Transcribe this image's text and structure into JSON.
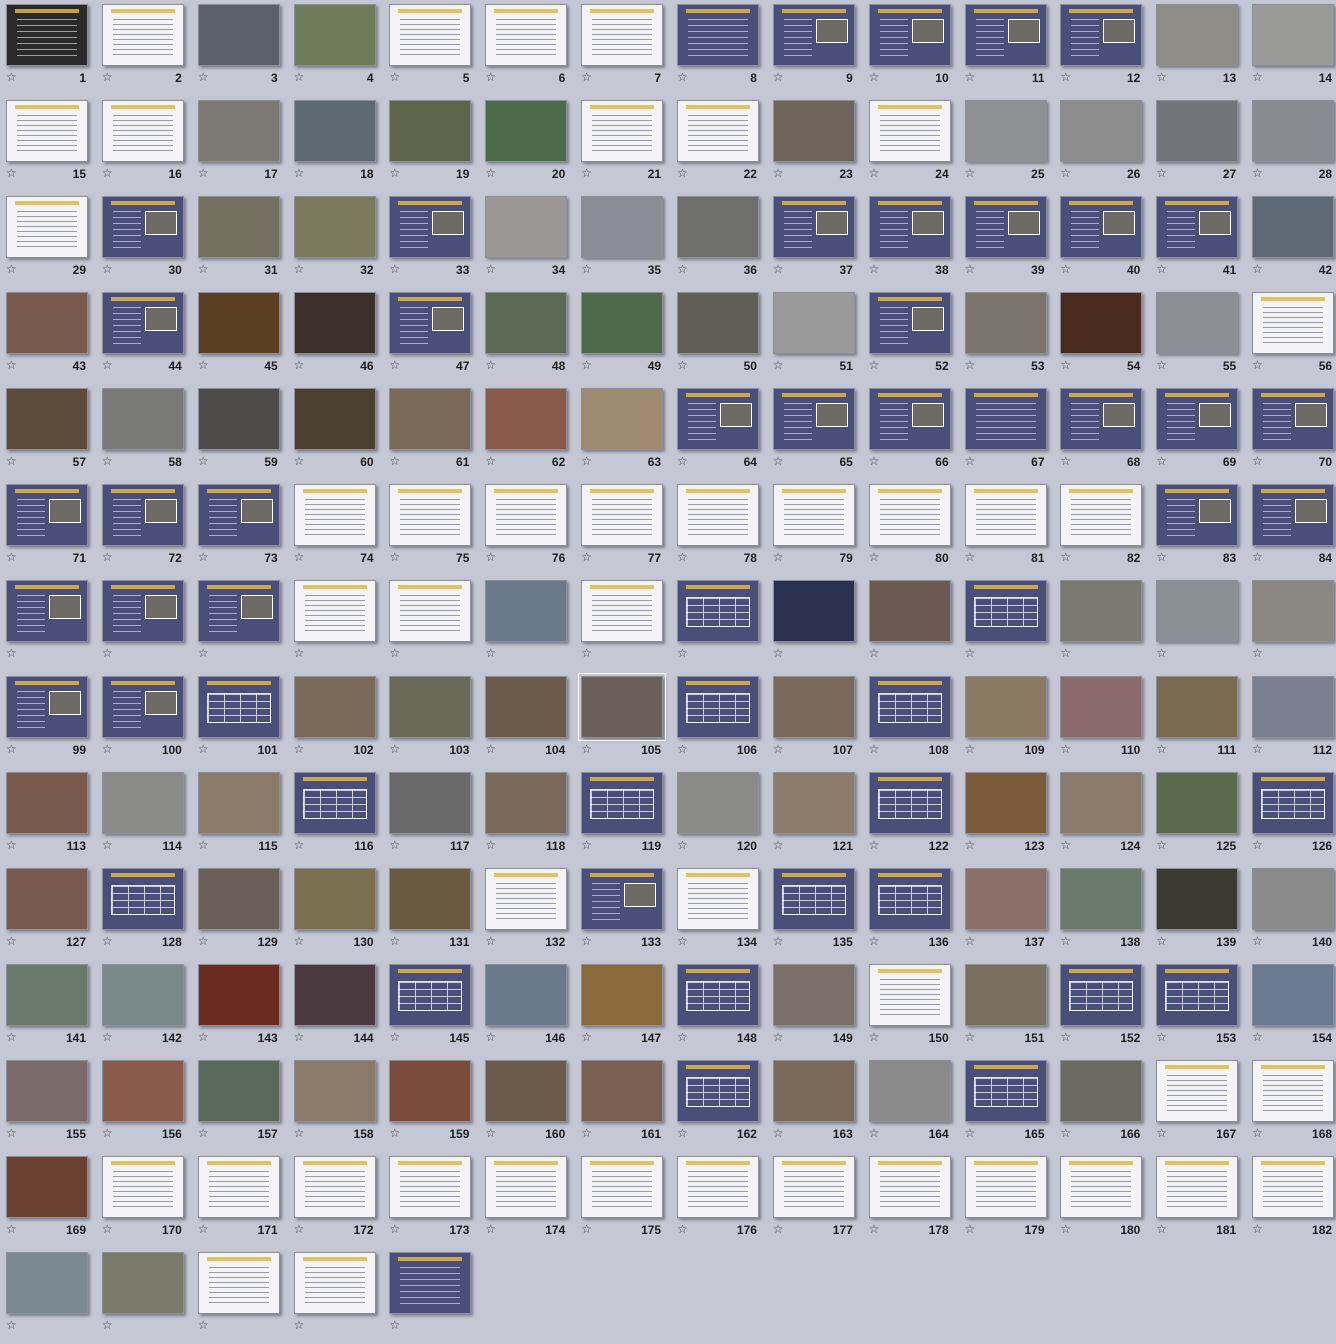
{
  "slides": [
    {
      "number": "1",
      "style": "dark"
    },
    {
      "number": "2",
      "style": "white"
    },
    {
      "number": "3",
      "style": "photo",
      "color": "#5a5f6a"
    },
    {
      "number": "4",
      "style": "photo",
      "color": "#6f7c5a"
    },
    {
      "number": "5",
      "style": "white"
    },
    {
      "number": "6",
      "style": "white"
    },
    {
      "number": "7",
      "style": "white"
    },
    {
      "number": "8",
      "style": "blue"
    },
    {
      "number": "9",
      "style": "blue-photo"
    },
    {
      "number": "10",
      "style": "blue-photo"
    },
    {
      "number": "11",
      "style": "blue-photo"
    },
    {
      "number": "12",
      "style": "blue-photo"
    },
    {
      "number": "13",
      "style": "photo",
      "color": "#8d8c86"
    },
    {
      "number": "14",
      "style": "photo",
      "color": "#9a9a98"
    },
    {
      "number": "15",
      "style": "white"
    },
    {
      "number": "16",
      "style": "white"
    },
    {
      "number": "17",
      "style": "photo",
      "color": "#7d7a73"
    },
    {
      "number": "18",
      "style": "photo",
      "color": "#5e6a72"
    },
    {
      "number": "19",
      "style": "photo",
      "color": "#5d6447"
    },
    {
      "number": "20",
      "style": "photo",
      "color": "#4b6a48"
    },
    {
      "number": "21",
      "style": "white"
    },
    {
      "number": "22",
      "style": "white"
    },
    {
      "number": "23",
      "style": "photo",
      "color": "#6f665b"
    },
    {
      "number": "24",
      "style": "white"
    },
    {
      "number": "25",
      "style": "photo",
      "color": "#8f9093"
    },
    {
      "number": "26",
      "style": "photo",
      "color": "#8c8c8c"
    },
    {
      "number": "27",
      "style": "photo",
      "color": "#73747a"
    },
    {
      "number": "28",
      "style": "photo",
      "color": "#8a8b90"
    },
    {
      "number": "29",
      "style": "white"
    },
    {
      "number": "30",
      "style": "blue-photo"
    },
    {
      "number": "31",
      "style": "photo",
      "color": "#74705f"
    },
    {
      "number": "32",
      "style": "photo",
      "color": "#7b7a5d"
    },
    {
      "number": "33",
      "style": "blue-photo"
    },
    {
      "number": "34",
      "style": "photo",
      "color": "#9b9795"
    },
    {
      "number": "35",
      "style": "photo",
      "color": "#8a8d95"
    },
    {
      "number": "36",
      "style": "photo",
      "color": "#6e6e6a"
    },
    {
      "number": "37",
      "style": "blue-photo"
    },
    {
      "number": "38",
      "style": "blue-photo"
    },
    {
      "number": "39",
      "style": "blue-photo"
    },
    {
      "number": "40",
      "style": "blue-photo"
    },
    {
      "number": "41",
      "style": "blue-photo"
    },
    {
      "number": "42",
      "style": "photo",
      "color": "#5e6a76"
    },
    {
      "number": "43",
      "style": "photo",
      "color": "#7a5a4c"
    },
    {
      "number": "44",
      "style": "blue-photo"
    },
    {
      "number": "45",
      "style": "photo",
      "color": "#5b3f22"
    },
    {
      "number": "46",
      "style": "photo",
      "color": "#3b2f2a"
    },
    {
      "number": "47",
      "style": "blue-photo"
    },
    {
      "number": "48",
      "style": "photo",
      "color": "#5c6a55"
    },
    {
      "number": "49",
      "style": "photo",
      "color": "#4f6a4a"
    },
    {
      "number": "50",
      "style": "photo",
      "color": "#5f5f56"
    },
    {
      "number": "51",
      "style": "photo",
      "color": "#9a9a9a"
    },
    {
      "number": "52",
      "style": "blue-photo"
    },
    {
      "number": "53",
      "style": "photo",
      "color": "#7b746a"
    },
    {
      "number": "54",
      "style": "photo",
      "color": "#4a2a1c"
    },
    {
      "number": "55",
      "style": "photo",
      "color": "#8c8f95"
    },
    {
      "number": "56",
      "style": "white"
    },
    {
      "number": "57",
      "style": "photo",
      "color": "#5c4a3a"
    },
    {
      "number": "58",
      "style": "photo",
      "color": "#7a7a78"
    },
    {
      "number": "59",
      "style": "photo",
      "color": "#4d4c4a"
    },
    {
      "number": "60",
      "style": "photo",
      "color": "#4b3f30"
    },
    {
      "number": "61",
      "style": "photo",
      "color": "#7a6a58"
    },
    {
      "number": "62",
      "style": "photo",
      "color": "#8a5a4a"
    },
    {
      "number": "63",
      "style": "photo",
      "color": "#a08a70"
    },
    {
      "number": "64",
      "style": "blue-photo"
    },
    {
      "number": "65",
      "style": "blue-photo"
    },
    {
      "number": "66",
      "style": "blue-photo"
    },
    {
      "number": "67",
      "style": "blue"
    },
    {
      "number": "68",
      "style": "blue-photo"
    },
    {
      "number": "69",
      "style": "blue-photo"
    },
    {
      "number": "70",
      "style": "blue-photo"
    },
    {
      "number": "71",
      "style": "blue-photo"
    },
    {
      "number": "72",
      "style": "blue-photo"
    },
    {
      "number": "73",
      "style": "blue-photo"
    },
    {
      "number": "74",
      "style": "white"
    },
    {
      "number": "75",
      "style": "white"
    },
    {
      "number": "76",
      "style": "white"
    },
    {
      "number": "77",
      "style": "white"
    },
    {
      "number": "78",
      "style": "white"
    },
    {
      "number": "79",
      "style": "white"
    },
    {
      "number": "80",
      "style": "white"
    },
    {
      "number": "81",
      "style": "white"
    },
    {
      "number": "82",
      "style": "white"
    },
    {
      "number": "83",
      "style": "blue-photo"
    },
    {
      "number": "84",
      "style": "blue-photo"
    },
    {
      "number": "",
      "style": "blue-photo"
    },
    {
      "number": "",
      "style": "blue-photo"
    },
    {
      "number": "",
      "style": "blue-photo"
    },
    {
      "number": "",
      "style": "white"
    },
    {
      "number": "",
      "style": "white"
    },
    {
      "number": "",
      "style": "photo",
      "color": "#6a7a8a"
    },
    {
      "number": "",
      "style": "white"
    },
    {
      "number": "",
      "style": "table"
    },
    {
      "number": "",
      "style": "photo",
      "color": "#2a3050"
    },
    {
      "number": "",
      "style": "photo",
      "color": "#6a5a52"
    },
    {
      "number": "",
      "style": "table"
    },
    {
      "number": "",
      "style": "photo",
      "color": "#7a7a70"
    },
    {
      "number": "",
      "style": "photo",
      "color": "#8a9096"
    },
    {
      "number": "",
      "style": "photo",
      "color": "#8a8680"
    },
    {
      "number": "99",
      "style": "blue-photo"
    },
    {
      "number": "100",
      "style": "blue-photo"
    },
    {
      "number": "101",
      "style": "table"
    },
    {
      "number": "102",
      "style": "photo",
      "color": "#7a6a5a"
    },
    {
      "number": "103",
      "style": "photo",
      "color": "#6a6a58"
    },
    {
      "number": "104",
      "style": "photo",
      "color": "#6a5a4a"
    },
    {
      "number": "105",
      "style": "photo",
      "color": "#6a6058",
      "selected": true
    },
    {
      "number": "106",
      "style": "table"
    },
    {
      "number": "107",
      "style": "photo",
      "color": "#7a6a5c"
    },
    {
      "number": "108",
      "style": "table"
    },
    {
      "number": "109",
      "style": "photo",
      "color": "#8a7a62"
    },
    {
      "number": "110",
      "style": "photo",
      "color": "#8a6a6a"
    },
    {
      "number": "111",
      "style": "photo",
      "color": "#7a6a50"
    },
    {
      "number": "112",
      "style": "photo",
      "color": "#7a8090"
    },
    {
      "number": "113",
      "style": "photo",
      "color": "#7a5a4a"
    },
    {
      "number": "114",
      "style": "photo",
      "color": "#8a8a88"
    },
    {
      "number": "115",
      "style": "photo",
      "color": "#8a7a68"
    },
    {
      "number": "116",
      "style": "table"
    },
    {
      "number": "117",
      "style": "photo",
      "color": "#6a6a6a"
    },
    {
      "number": "118",
      "style": "photo",
      "color": "#7a6a5c"
    },
    {
      "number": "119",
      "style": "table"
    },
    {
      "number": "120",
      "style": "photo",
      "color": "#8a8a86"
    },
    {
      "number": "121",
      "style": "photo",
      "color": "#8a7a6a"
    },
    {
      "number": "122",
      "style": "table"
    },
    {
      "number": "123",
      "style": "photo",
      "color": "#7a5a3a"
    },
    {
      "number": "124",
      "style": "photo",
      "color": "#8a7a6a"
    },
    {
      "number": "125",
      "style": "photo",
      "color": "#5a6a4a"
    },
    {
      "number": "126",
      "style": "table"
    },
    {
      "number": "127",
      "style": "photo",
      "color": "#7a5a50"
    },
    {
      "number": "128",
      "style": "table"
    },
    {
      "number": "129",
      "style": "photo",
      "color": "#6a6058"
    },
    {
      "number": "130",
      "style": "photo",
      "color": "#7a7050"
    },
    {
      "number": "131",
      "style": "photo",
      "color": "#6a5a40"
    },
    {
      "number": "132",
      "style": "white"
    },
    {
      "number": "133",
      "style": "blue-photo"
    },
    {
      "number": "134",
      "style": "white"
    },
    {
      "number": "135",
      "style": "table"
    },
    {
      "number": "136",
      "style": "table"
    },
    {
      "number": "137",
      "style": "photo",
      "color": "#8a7068"
    },
    {
      "number": "138",
      "style": "photo",
      "color": "#6a7a6a"
    },
    {
      "number": "139",
      "style": "photo",
      "color": "#3a3a30"
    },
    {
      "number": "140",
      "style": "photo",
      "color": "#8a8a8a"
    },
    {
      "number": "141",
      "style": "photo",
      "color": "#6a7a6a"
    },
    {
      "number": "142",
      "style": "photo",
      "color": "#7a8a8a"
    },
    {
      "number": "143",
      "style": "photo",
      "color": "#6a2a20"
    },
    {
      "number": "144",
      "style": "photo",
      "color": "#4a3a40"
    },
    {
      "number": "145",
      "style": "table"
    },
    {
      "number": "146",
      "style": "photo",
      "color": "#6a7a8a"
    },
    {
      "number": "147",
      "style": "photo",
      "color": "#8a6a3a"
    },
    {
      "number": "148",
      "style": "table"
    },
    {
      "number": "149",
      "style": "photo",
      "color": "#7a7068"
    },
    {
      "number": "150",
      "style": "white"
    },
    {
      "number": "151",
      "style": "photo",
      "color": "#7a7060"
    },
    {
      "number": "152",
      "style": "table"
    },
    {
      "number": "153",
      "style": "table"
    },
    {
      "number": "154",
      "style": "photo",
      "color": "#6a7a90"
    },
    {
      "number": "155",
      "style": "photo",
      "color": "#7a6a6a"
    },
    {
      "number": "156",
      "style": "photo",
      "color": "#8a5a4a"
    },
    {
      "number": "157",
      "style": "photo",
      "color": "#5a6a5a"
    },
    {
      "number": "158",
      "style": "photo",
      "color": "#8a7a6a"
    },
    {
      "number": "159",
      "style": "photo",
      "color": "#7a4a3a"
    },
    {
      "number": "160",
      "style": "photo",
      "color": "#6a5a4a"
    },
    {
      "number": "161",
      "style": "photo",
      "color": "#7a6050"
    },
    {
      "number": "162",
      "style": "table"
    },
    {
      "number": "163",
      "style": "photo",
      "color": "#7a6a5a"
    },
    {
      "number": "164",
      "style": "photo",
      "color": "#8a8a8a"
    },
    {
      "number": "165",
      "style": "table"
    },
    {
      "number": "166",
      "style": "photo",
      "color": "#6a6a60"
    },
    {
      "number": "167",
      "style": "white"
    },
    {
      "number": "168",
      "style": "white"
    },
    {
      "number": "169",
      "style": "photo",
      "color": "#6a4030"
    },
    {
      "number": "170",
      "style": "white"
    },
    {
      "number": "171",
      "style": "white"
    },
    {
      "number": "172",
      "style": "white"
    },
    {
      "number": "173",
      "style": "white"
    },
    {
      "number": "174",
      "style": "white"
    },
    {
      "number": "175",
      "style": "white"
    },
    {
      "number": "176",
      "style": "white"
    },
    {
      "number": "177",
      "style": "white"
    },
    {
      "number": "178",
      "style": "white"
    },
    {
      "number": "179",
      "style": "white"
    },
    {
      "number": "180",
      "style": "white"
    },
    {
      "number": "181",
      "style": "white"
    },
    {
      "number": "182",
      "style": "white"
    },
    {
      "number": "",
      "style": "photo",
      "color": "#7a8a90"
    },
    {
      "number": "",
      "style": "photo",
      "color": "#7a7a6a"
    },
    {
      "number": "",
      "style": "white"
    },
    {
      "number": "",
      "style": "white"
    },
    {
      "number": "",
      "style": "blue"
    }
  ],
  "star_glyph": "☆",
  "colors": {
    "background": "#c5c8d4",
    "slide_blue": "#4a4f7a",
    "slide_white": "#f4f4f6",
    "slide_dark": "#2a2a2a",
    "accent": "#e0b64a"
  }
}
